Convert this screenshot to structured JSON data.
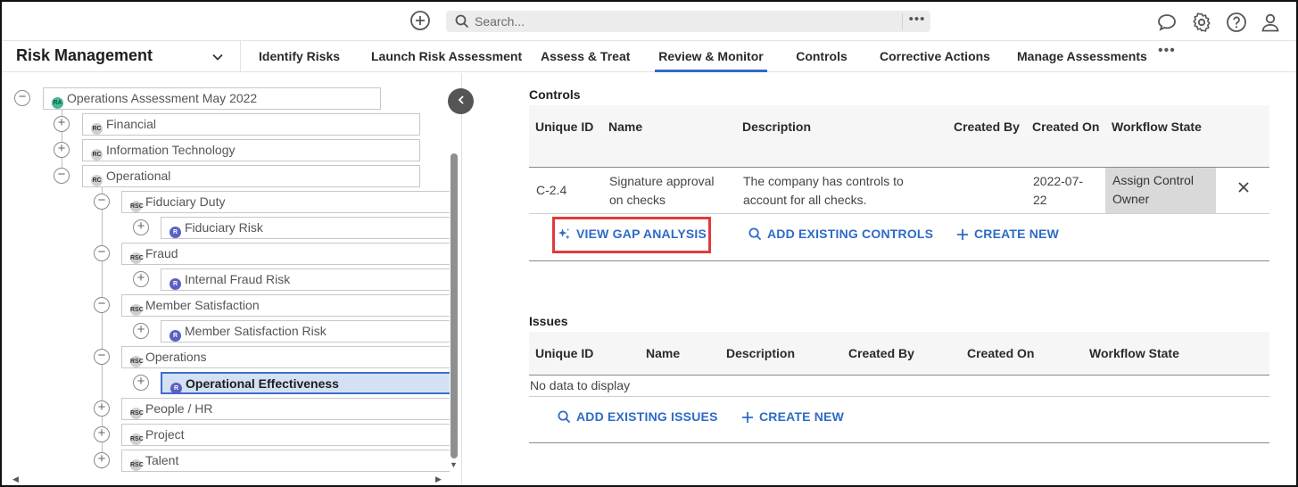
{
  "topbar": {
    "search_placeholder": "Search...",
    "more_label": "•••"
  },
  "nav": {
    "app_title": "Risk Management",
    "tabs": [
      {
        "label": "Identify Risks"
      },
      {
        "label": "Launch Risk Assessment"
      },
      {
        "label": "Assess & Treat"
      },
      {
        "label": "Review & Monitor",
        "active": true
      },
      {
        "label": "Controls"
      },
      {
        "label": "Corrective Actions"
      },
      {
        "label": "Manage Assessments"
      }
    ],
    "more_label": "•••"
  },
  "tree": {
    "root": {
      "badge": "RA",
      "label": "Operations Assessment May 2022"
    },
    "items": [
      {
        "badge": "RC",
        "label": "Financial"
      },
      {
        "badge": "RC",
        "label": "Information Technology"
      },
      {
        "badge": "RC",
        "label": "Operational"
      },
      {
        "badge": "RSC",
        "label": "Fiduciary Duty"
      },
      {
        "badge": "R",
        "label": "Fiduciary Risk"
      },
      {
        "badge": "RSC",
        "label": "Fraud"
      },
      {
        "badge": "R",
        "label": "Internal Fraud Risk"
      },
      {
        "badge": "RSC",
        "label": "Member Satisfaction"
      },
      {
        "badge": "R",
        "label": "Member Satisfaction Risk"
      },
      {
        "badge": "RSC",
        "label": "Operations"
      },
      {
        "badge": "R",
        "label": "Operational Effectiveness",
        "selected": true
      },
      {
        "badge": "RSC",
        "label": "People / HR"
      },
      {
        "badge": "RSC",
        "label": "Project"
      },
      {
        "badge": "RSC",
        "label": "Talent"
      }
    ]
  },
  "controls": {
    "title": "Controls",
    "headers": [
      "Unique ID",
      "Name",
      "Description",
      "Created By",
      "Created On",
      "Workflow State"
    ],
    "row": {
      "id": "C-2.4",
      "name_l1": "Signature approval",
      "name_l2": "on checks",
      "desc_l1": "The company has controls to",
      "desc_l2": "account for all checks.",
      "created_by": "",
      "created_on_l1": "2022-07-",
      "created_on_l2": "22",
      "state_l1": "Assign Control",
      "state_l2": "Owner"
    },
    "actions": {
      "gap": "VIEW GAP ANALYSIS",
      "add_existing": "ADD EXISTING CONTROLS",
      "create_new": "CREATE NEW"
    }
  },
  "issues": {
    "title": "Issues",
    "headers": [
      "Unique ID",
      "Name",
      "Description",
      "Created By",
      "Created On",
      "Workflow State"
    ],
    "empty": "No data to display",
    "actions": {
      "add_existing": "ADD EXISTING ISSUES",
      "create_new": "CREATE NEW"
    }
  },
  "colors": {
    "accent": "#2e6bc6",
    "highlight": "#e23a3a",
    "selected_bg": "#d4e0f3"
  }
}
